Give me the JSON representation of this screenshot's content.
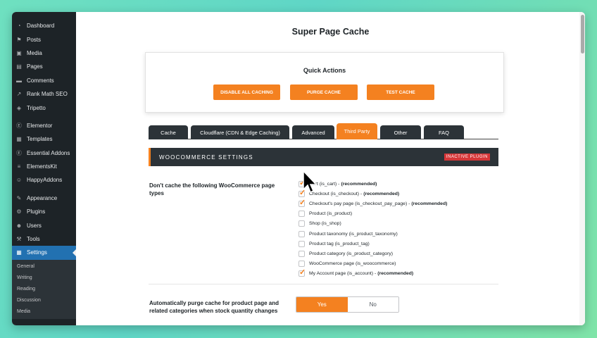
{
  "sidebar": {
    "items": [
      {
        "label": "Dashboard",
        "icon": "dashboard-icon"
      },
      {
        "label": "Posts",
        "icon": "pin-icon"
      },
      {
        "label": "Media",
        "icon": "media-icon"
      },
      {
        "label": "Pages",
        "icon": "pages-icon"
      },
      {
        "label": "Comments",
        "icon": "comments-icon"
      },
      {
        "label": "Rank Math SEO",
        "icon": "rankmath-icon"
      },
      {
        "label": "Tripetto",
        "icon": "tripetto-icon"
      },
      {
        "label": "Elementor",
        "icon": "elementor-icon"
      },
      {
        "label": "Templates",
        "icon": "templates-icon"
      },
      {
        "label": "Essential Addons",
        "icon": "essential-addons-icon"
      },
      {
        "label": "ElementsKit",
        "icon": "elementskit-icon"
      },
      {
        "label": "HappyAddons",
        "icon": "happyaddons-icon"
      },
      {
        "label": "Appearance",
        "icon": "appearance-icon"
      },
      {
        "label": "Plugins",
        "icon": "plugins-icon"
      },
      {
        "label": "Users",
        "icon": "users-icon"
      },
      {
        "label": "Tools",
        "icon": "tools-icon"
      },
      {
        "label": "Settings",
        "icon": "settings-icon"
      }
    ],
    "submenu": [
      "General",
      "Writing",
      "Reading",
      "Discussion",
      "Media"
    ]
  },
  "page": {
    "title": "Super Page Cache"
  },
  "quick_actions": {
    "title": "Quick Actions",
    "buttons": [
      "DISABLE ALL CACHING",
      "PURGE CACHE",
      "TEST CACHE"
    ]
  },
  "tabs": [
    "Cache",
    "Cloudflare (CDN & Edge Caching)",
    "Advanced",
    "Third Party",
    "Other",
    "FAQ"
  ],
  "woocommerce": {
    "title": "WOOCOMMERCE SETTINGS",
    "badge": "INACTIVE PLUGIN",
    "q1": "Don't cache the following WooCommerce page types",
    "options": [
      {
        "label": "Cart (is_cart) - ",
        "rec": "(recommended)",
        "checked": true
      },
      {
        "label": "Checkout (is_checkout) - ",
        "rec": "(recommended)",
        "checked": true
      },
      {
        "label": "Checkout's pay page (is_checkout_pay_page) - ",
        "rec": "(recommended)",
        "checked": true
      },
      {
        "label": "Product (is_product)",
        "rec": "",
        "checked": false
      },
      {
        "label": "Shop (is_shop)",
        "rec": "",
        "checked": false
      },
      {
        "label": "Product taxonomy (is_product_taxonomy)",
        "rec": "",
        "checked": false
      },
      {
        "label": "Product tag (is_product_tag)",
        "rec": "",
        "checked": false
      },
      {
        "label": "Product category (is_product_category)",
        "rec": "",
        "checked": false
      },
      {
        "label": "WooCommerce page (is_woocommerce)",
        "rec": "",
        "checked": false
      },
      {
        "label": "My Account page (is_account) - ",
        "rec": "(recommended)",
        "checked": true
      }
    ],
    "q2": "Automatically purge cache for product page and related categories when stock quantity changes",
    "toggle": {
      "yes": "Yes",
      "no": "No",
      "selected": "Yes"
    }
  },
  "colors": {
    "accent": "#f48120",
    "sidebar": "#1d2327",
    "active": "#2271b1",
    "badge": "#d63638"
  }
}
